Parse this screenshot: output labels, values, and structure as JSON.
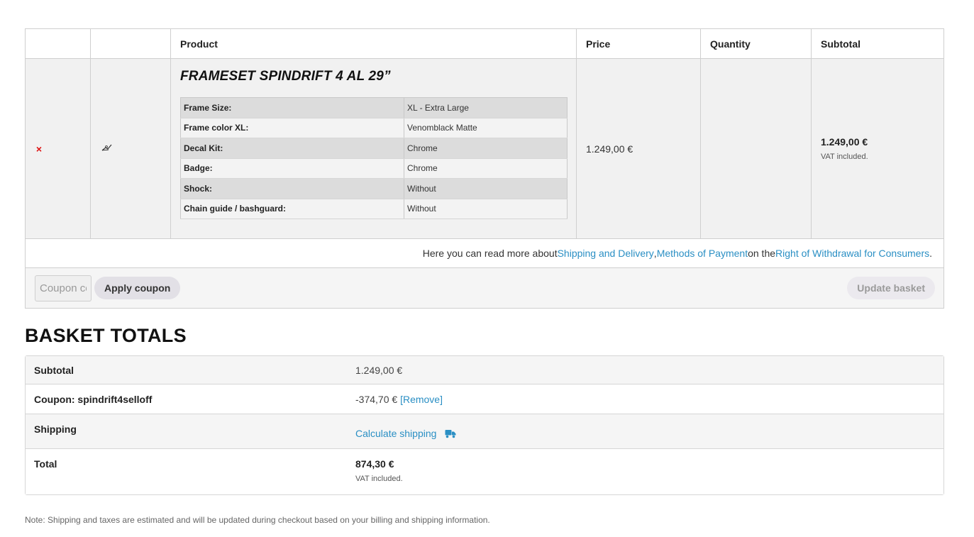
{
  "cart": {
    "headers": {
      "remove": "",
      "thumbnail": "",
      "product": "Product",
      "price": "Price",
      "quantity": "Quantity",
      "subtotal": "Subtotal"
    },
    "item": {
      "remove_symbol": "×",
      "thumbnail_icon": "pencil-like-icon",
      "title": "FRAMESET SPINDRIFT 4 AL 29”",
      "variations": [
        {
          "label": "Frame Size:",
          "value": "XL - Extra Large"
        },
        {
          "label": "Frame color XL:",
          "value": "Venomblack Matte"
        },
        {
          "label": "Decal Kit:",
          "value": "Chrome"
        },
        {
          "label": "Badge:",
          "value": "Chrome"
        },
        {
          "label": "Shock:",
          "value": "Without"
        },
        {
          "label": "Chain guide / bashguard:",
          "value": "Without"
        }
      ],
      "price": "1.249,00 €",
      "quantity": "",
      "subtotal": "1.249,00 €",
      "vat_note": "VAT included."
    },
    "info": {
      "prefix": "Here you can read more about ",
      "link_shipping": "Shipping and Delivery",
      "sep": ", ",
      "link_payment": "Methods of Payment",
      "middle": " on the ",
      "link_withdrawal": "Right of Withdrawal for Consumers",
      "suffix": "."
    },
    "actions": {
      "coupon_placeholder": "Coupon code",
      "apply_label": "Apply coupon",
      "update_label": "Update basket"
    }
  },
  "totals": {
    "title": "BASKET TOTALS",
    "subtotal_label": "Subtotal",
    "subtotal_value": "1.249,00 €",
    "coupon_label": "Coupon: spindrift4selloff",
    "coupon_value": "-374,70 €",
    "coupon_remove": "[Remove]",
    "shipping_label": "Shipping",
    "shipping_link": "Calculate shipping",
    "total_label": "Total",
    "total_value": "874,30 €",
    "total_vat": "VAT included."
  },
  "note": "Note: Shipping and taxes are estimated and will be updated during checkout based on your billing and shipping information.",
  "colors": {
    "link": "#2a8fc4",
    "remove": "#dd1111",
    "row_bg": "#f1f1f1"
  }
}
